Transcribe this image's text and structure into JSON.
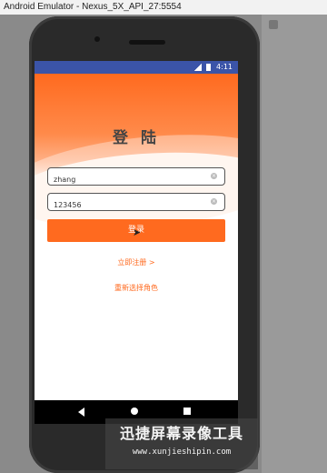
{
  "window": {
    "title": "Android Emulator - Nexus_5X_API_27:5554"
  },
  "statusbar": {
    "time": "4:11"
  },
  "login": {
    "title": "登 陆",
    "username_value": "zhang",
    "password_value": "123456",
    "login_button": "登录",
    "register_link": "立即注册 >",
    "reselect_role_link": "重新选择角色"
  },
  "watermark": {
    "title": "迅捷屏幕录像工具",
    "url": "www.xunjieshipin.com"
  },
  "colors": {
    "accent": "#ff6a1f",
    "statusbar": "#3b54a8"
  },
  "icons": [
    "signal-icon",
    "battery-icon",
    "clear-text-icon",
    "back-nav-icon",
    "home-nav-icon",
    "recents-nav-icon",
    "mouse-cursor-icon"
  ]
}
